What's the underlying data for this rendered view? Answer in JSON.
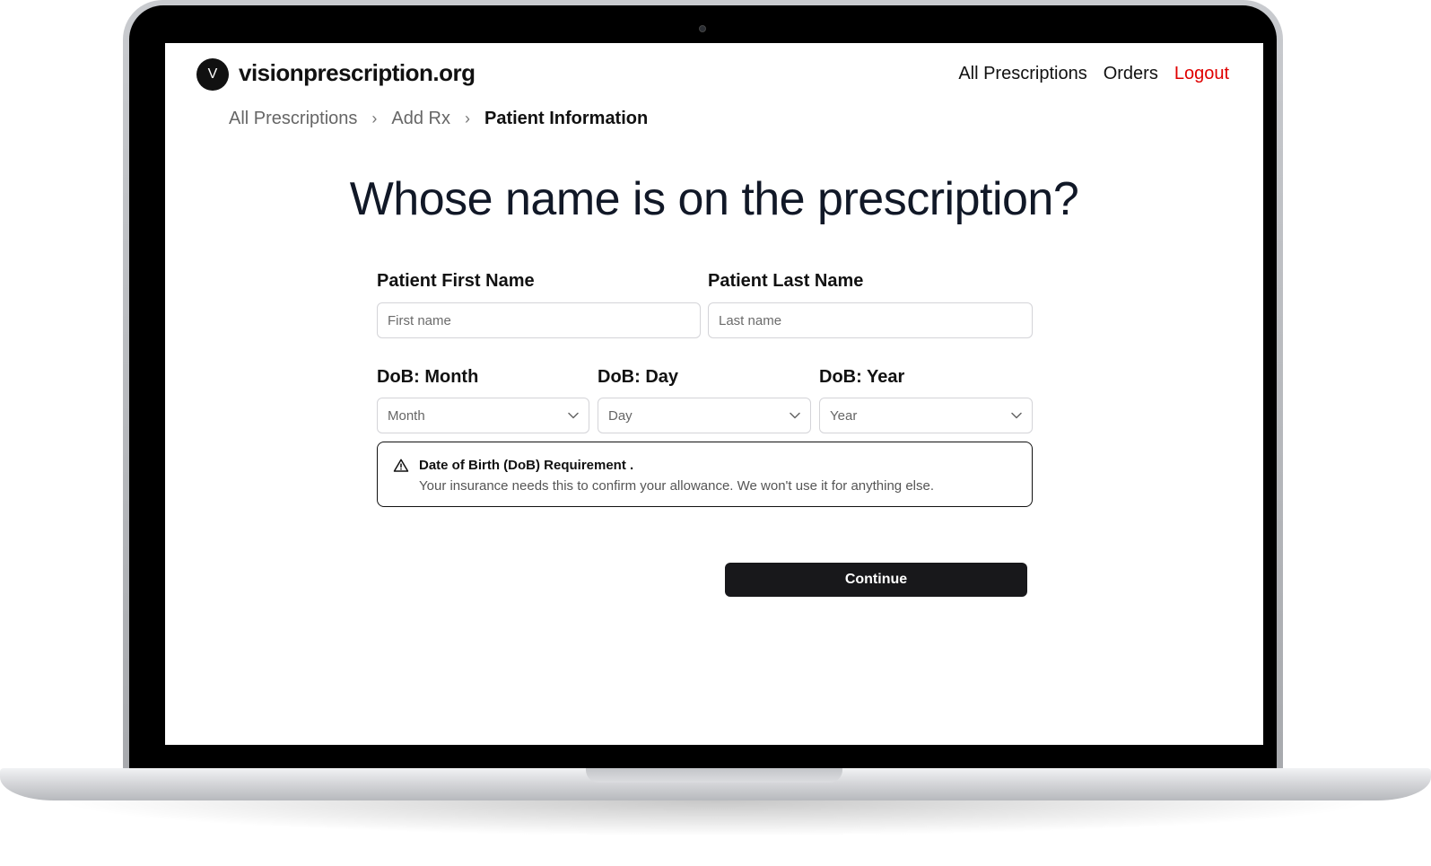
{
  "brand": {
    "logo_letter": "V",
    "name": "visionprescription.org"
  },
  "nav": {
    "items": [
      "All Prescriptions",
      "Orders"
    ],
    "logout": "Logout"
  },
  "breadcrumb": {
    "items": [
      "All Prescriptions",
      "Add Rx"
    ],
    "current": "Patient Information",
    "separator": "›"
  },
  "page": {
    "title": "Whose name is on the prescription?"
  },
  "form": {
    "first_name": {
      "label": "Patient First Name",
      "placeholder": "First name",
      "value": ""
    },
    "last_name": {
      "label": "Patient Last Name",
      "placeholder": "Last name",
      "value": ""
    },
    "dob_month": {
      "label": "DoB: Month",
      "selected": "Month"
    },
    "dob_day": {
      "label": "DoB: Day",
      "selected": "Day"
    },
    "dob_year": {
      "label": "DoB: Year",
      "selected": "Year"
    }
  },
  "alert": {
    "icon": "warning-triangle-icon",
    "title": "Date of Birth (DoB) Requirement .",
    "description": "Your insurance needs this to confirm your allowance. We won't use it for anything else."
  },
  "actions": {
    "continue_label": "Continue"
  },
  "colors": {
    "accent_logout": "#e00000",
    "button_bg": "#18181b",
    "title_color": "#111827"
  }
}
